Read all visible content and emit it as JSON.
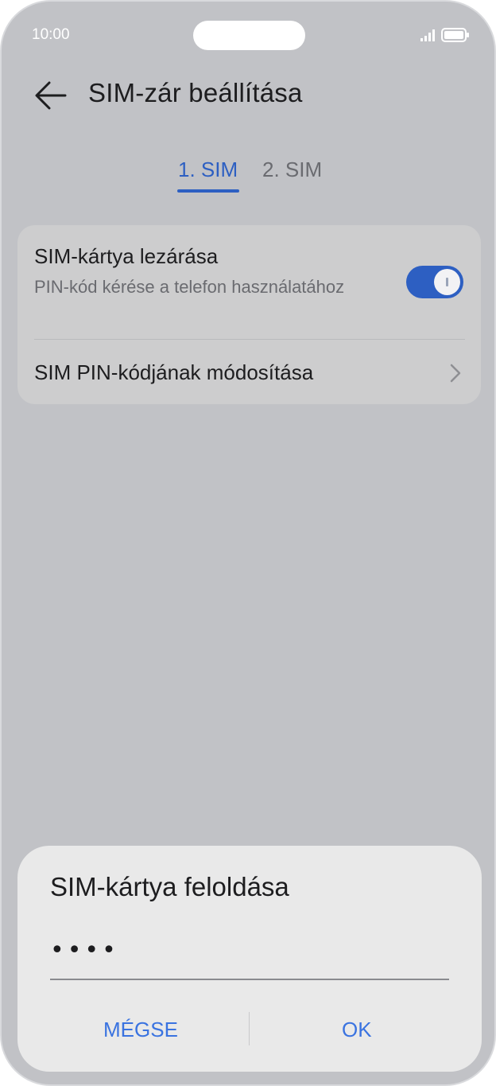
{
  "status_bar": {
    "time": "10:00",
    "icons": [
      "signal-icon",
      "battery-icon"
    ]
  },
  "header": {
    "title": "SIM-zár beállítása",
    "back_icon": "back-arrow-icon"
  },
  "tabs": [
    {
      "label": "1. SIM",
      "selected": true
    },
    {
      "label": "2. SIM",
      "selected": false
    }
  ],
  "settings": {
    "lock_sim": {
      "title": "SIM-kártya lezárása",
      "subtitle": "PIN-kód kérése a telefon használatához",
      "toggle_on": true
    },
    "change_pin": {
      "title": "SIM PIN-kódjának módosítása",
      "icon": "chevron-right-icon"
    }
  },
  "dialog": {
    "title": "SIM-kártya feloldása",
    "pin_value": "••••",
    "cancel_label": "MÉGSE",
    "ok_label": "OK"
  },
  "colors": {
    "accent": "#2d5fc2",
    "dialog_button": "#3a73e0",
    "background": "#c1c2c6"
  }
}
